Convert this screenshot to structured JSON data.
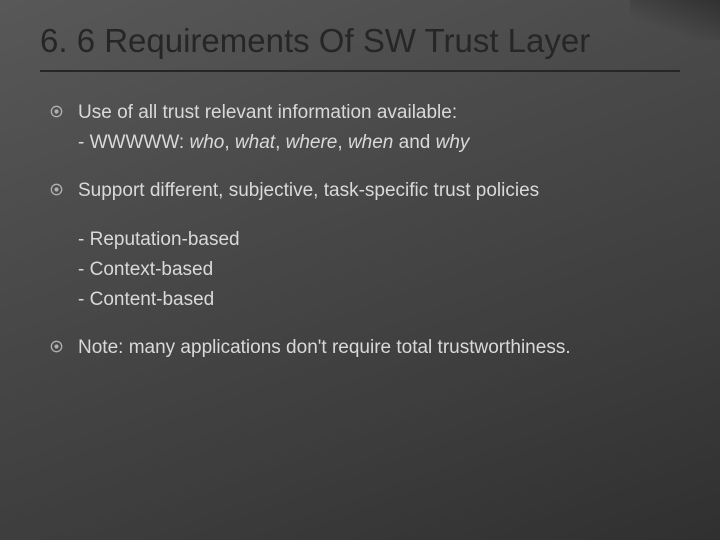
{
  "title": "6. 6 Requirements Of SW Trust Layer",
  "items": [
    {
      "text": "Use of all trust relevant information available:",
      "sub_prefix": "- WWWWW: ",
      "sub_who": "who",
      "sub_c1": ", ",
      "sub_what": "what",
      "sub_c2": ", ",
      "sub_where": "where",
      "sub_c3": ", ",
      "sub_when": "when",
      "sub_and": " and ",
      "sub_why": "why"
    },
    {
      "text": "Support different, subjective, task-specific trust policies",
      "subs": [
        "- Reputation-based",
        "- Context-based",
        "- Content-based"
      ]
    },
    {
      "text": "Note: many applications don't require total trustworthiness."
    }
  ]
}
